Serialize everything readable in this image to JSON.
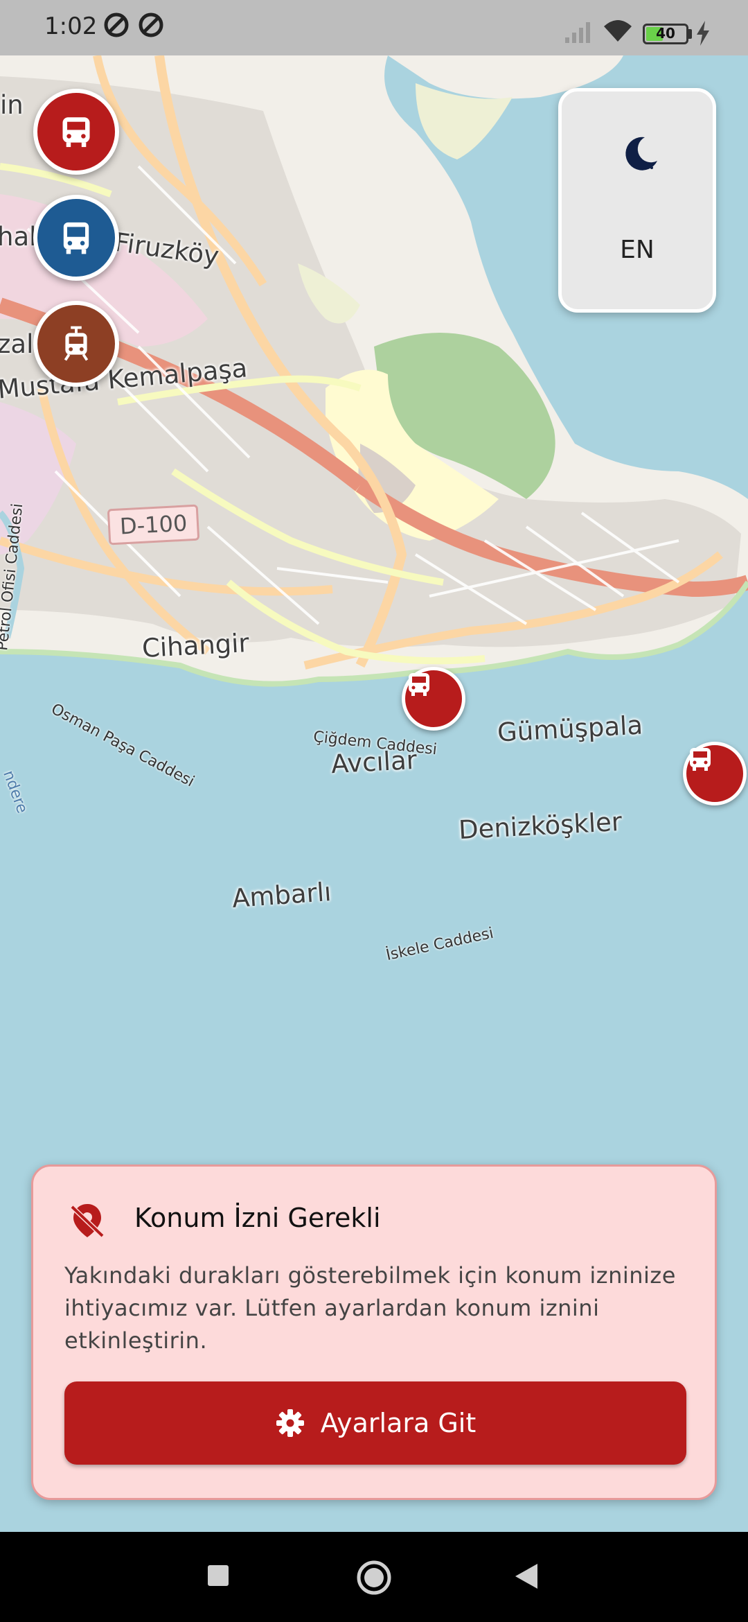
{
  "status_bar": {
    "time": "1:02",
    "battery_level": "40"
  },
  "map": {
    "places": [
      "Firuzköy",
      "Mustafa Kemalpaşa",
      "Cihangir",
      "Avcılar",
      "Gümüşpala",
      "Denizköşkler",
      "Ambarlı"
    ],
    "places_partial": [
      "in",
      "hal",
      "zal"
    ],
    "road_shield": "D-100",
    "streets": [
      "Petrol Ofisi Caddesi",
      "Osman Paşa Caddesi",
      "Çiğdem Caddesi",
      "İskele Caddesi",
      "ndere"
    ]
  },
  "transit_filters": [
    {
      "icon": "metrobus-icon",
      "color": "#b71c1c"
    },
    {
      "icon": "bus-icon",
      "color": "#1e5b93"
    },
    {
      "icon": "tram-icon",
      "color": "#8d3f24"
    }
  ],
  "settings": {
    "theme_icon": "moon-icon",
    "language": "EN"
  },
  "permission_card": {
    "title": "Konum İzni Gerekli",
    "body": "Yakındaki durakları gösterebilmek için konum izninize ihtiyacımız var. Lütfen ayarlardan konum iznini etkinleştirin.",
    "button_label": "Ayarlara Git"
  },
  "colors": {
    "accent": "#b71c1c",
    "card_background": "#fddada",
    "water": "#aad3df"
  }
}
